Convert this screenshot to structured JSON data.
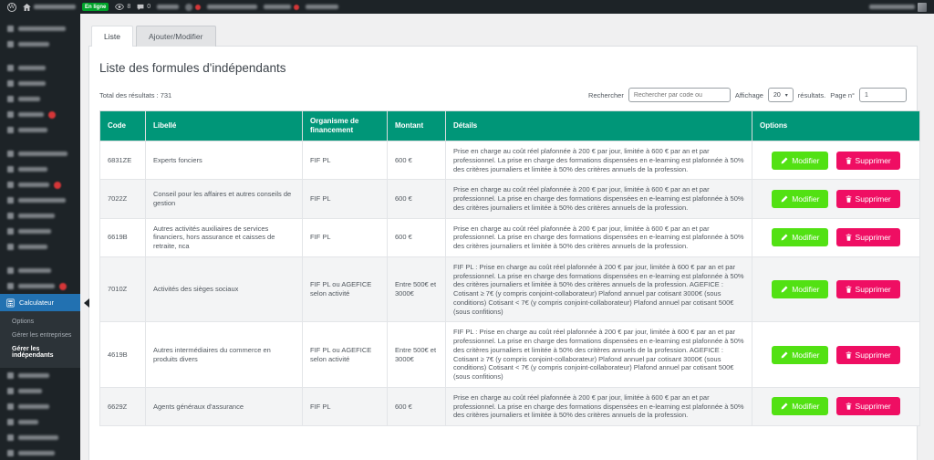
{
  "admin_bar": {
    "online_label": "En ligne",
    "views_count": "8",
    "comments_count": "0"
  },
  "sidebar": {
    "active_label": "Calculateur",
    "submenu": [
      {
        "label": "Options"
      },
      {
        "label": "Gérer les entreprises"
      },
      {
        "label": "Gérer les indépendants",
        "current": true
      }
    ]
  },
  "tabs": [
    {
      "label": "Liste",
      "active": true
    },
    {
      "label": "Ajouter/Modifier",
      "active": false
    }
  ],
  "page": {
    "title": "Liste des formules d'indépendants",
    "total_results": "Total des résultats : 731",
    "search_label": "Rechercher",
    "search_placeholder": "Rechercher par code ou",
    "display_label": "Affichage",
    "display_value": "20",
    "results_suffix": "résultats.",
    "page_label": "Page n°",
    "page_value": "1"
  },
  "table": {
    "columns": [
      "Code",
      "Libellé",
      "Organisme de financement",
      "Montant",
      "Détails",
      "Options"
    ],
    "edit_label": "Modifier",
    "delete_label": "Supprimer",
    "rows": [
      {
        "code": "6831ZE",
        "libelle": "Experts fonciers",
        "organisme": "FIF PL",
        "montant": "600 €",
        "details": "Prise en charge au coût réel plafonnée à 200 € par jour, limitée à 600 € par an et par professionnel. La prise en charge des formations dispensées en e-learning est plafonnée à 50% des critères journaliers et limitée à 50% des critères annuels de la profession."
      },
      {
        "code": "7022Z",
        "libelle": "Conseil pour les affaires et autres conseils de gestion",
        "organisme": "FIF PL",
        "montant": "600 €",
        "details": "Prise en charge au coût réel plafonnée à 200 € par jour, limitée à 600 € par an et par professionnel. La prise en charge des formations dispensées en e-learning est plafonnée à 50% des critères journaliers et limitée à 50% des critères annuels de la profession."
      },
      {
        "code": "6619B",
        "libelle": "Autres activités auxiliaires de services financiers, hors assurance et caisses de retraite, nca",
        "organisme": "FIF PL",
        "montant": "600 €",
        "details": "Prise en charge au coût réel plafonnée à 200 € par jour, limitée à 600 € par an et par professionnel. La prise en charge des formations dispensées en e-learning est plafonnée à 50% des critères journaliers et limitée à 50% des critères annuels de la profession."
      },
      {
        "code": "7010Z",
        "libelle": "Activités des sièges sociaux",
        "organisme": "FIF PL ou AGEFICE selon activité",
        "montant": "Entre 500€ et 3000€",
        "details": "FIF PL : Prise en charge au coût réel plafonnée à 200 € par jour, limitée à 600 € par an et par professionnel. La prise en charge des formations dispensées en e-learning est plafonnée à 50% des critères journaliers et limitée à 50% des critères annuels de la profession. AGEFICE : Cotisant ≥ 7€ (y compris conjoint-collaborateur) Plafond annuel par cotisant 3000€ (sous conditions) Cotisant < 7€ (y compris conjoint-collaborateur) Plafond annuel par cotisant 500€ (sous confitions)"
      },
      {
        "code": "4619B",
        "libelle": "Autres intermédiaires du commerce en produits divers",
        "organisme": "FIF PL ou AGEFICE selon activité",
        "montant": "Entre 500€ et 3000€",
        "details": "FIF PL : Prise en charge au coût réel plafonnée à 200 € par jour, limitée à 600 € par an et par professionnel. La prise en charge des formations dispensées en e-learning est plafonnée à 50% des critères journaliers et limitée à 50% des critères annuels de la profession. AGEFICE : Cotisant ≥ 7€ (y compris conjoint-collaborateur) Plafond annuel par cotisant 3000€ (sous conditions) Cotisant < 7€ (y compris conjoint-collaborateur) Plafond annuel par cotisant 500€ (sous confitions)"
      },
      {
        "code": "6629Z",
        "libelle": "Agents généraux d'assurance",
        "organisme": "FIF PL",
        "montant": "600 €",
        "details": "Prise en charge au coût réel plafonnée à 200 € par jour, limitée à 600 € par an et par professionnel. La prise en charge des formations dispensées en e-learning est plafonnée à 50% des critères journaliers et limitée à 50% des critères annuels de la profession."
      }
    ]
  },
  "colors": {
    "table_header_teal": "#009678",
    "edit_button_green": "#52e113",
    "delete_button_pink": "#ef0e63",
    "active_menu_blue": "#2271b1",
    "online_badge_green": "#00a32a",
    "notification_badge_red": "#d63638",
    "admin_dark": "#1d2327"
  }
}
